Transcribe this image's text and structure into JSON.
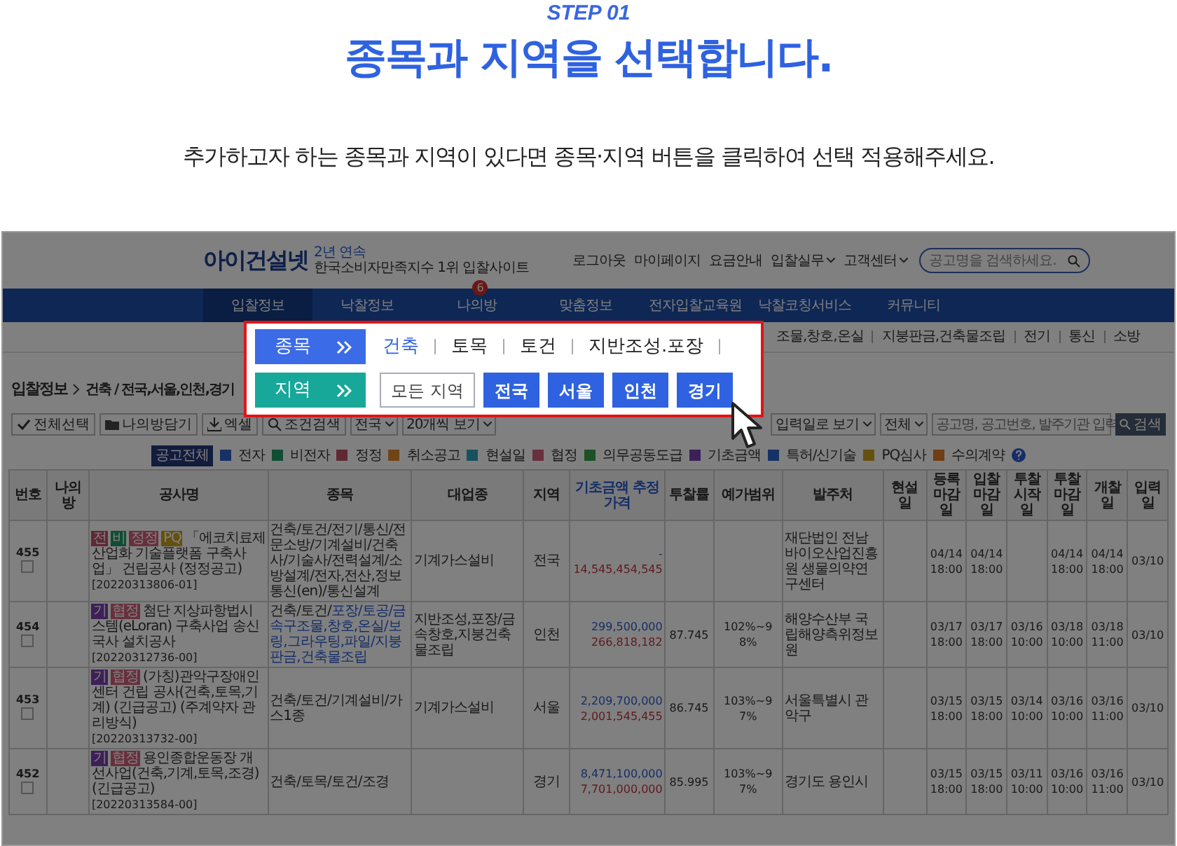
{
  "step": "STEP 01",
  "title": "종목과 지역을 선택합니다.",
  "subtitle": "추가하고자 하는 종목과 지역이 있다면 종목·지역 버튼을 클릭하여 선택 적용해주세요.",
  "site": {
    "logo": {
      "name": "아이건설넷",
      "award_top": "2년 연속",
      "award_text": "한국소비자만족지수 1위 입찰사이트"
    },
    "top_links": [
      {
        "label": "로그아웃",
        "dropdown": false
      },
      {
        "label": "마이페이지",
        "dropdown": false
      },
      {
        "label": "요금안내",
        "dropdown": false
      },
      {
        "label": "입찰실무",
        "dropdown": true
      },
      {
        "label": "고객센터",
        "dropdown": true
      }
    ],
    "search": {
      "placeholder": "공고명을 검색하세요."
    },
    "nav": [
      {
        "label": "입찰정보",
        "selected": true
      },
      {
        "label": "낙찰정보",
        "selected": false
      },
      {
        "label": "나의방",
        "selected": false,
        "badge": "6"
      },
      {
        "label": "맞춤정보",
        "selected": false
      },
      {
        "label": "전자입찰교육원",
        "selected": false
      },
      {
        "label": "낙찰코칭서비스",
        "selected": false
      },
      {
        "label": "커뮤니티",
        "selected": false
      }
    ],
    "subcategories": [
      "조물,창호,온실",
      "지붕판금,건축물조립",
      "전기",
      "통신",
      "소방"
    ],
    "breadcrumb": {
      "title": "입찰정보",
      "path": "건축 / 전국,서울,인천,경기"
    },
    "toolbar_left": [
      "전체선택",
      "나의방담기",
      "엑셀",
      "조건검색"
    ],
    "toolbar_right": {
      "selects": [
        "전국",
        "20개씩 보기",
        "입력일로 보기",
        "전체"
      ],
      "search_placeholder": "공고명, 공고번호, 발주기관 입력",
      "search_button": "검색"
    },
    "legend": {
      "filter": "공고전체",
      "items": [
        {
          "label": "전자",
          "color": "#163165"
        },
        {
          "label": "비전자",
          "color": "#104d35"
        },
        {
          "label": "정정",
          "color": "#602835"
        },
        {
          "label": "취소공고",
          "color": "#704515"
        },
        {
          "label": "현설일",
          "color": "#18505c"
        },
        {
          "label": "협정",
          "color": "#68303d"
        },
        {
          "label": "의무공동도급",
          "color": "#1d5025"
        },
        {
          "label": "기초금액",
          "color": "#3d2058"
        },
        {
          "label": "특허/신기술",
          "color": "#163165"
        },
        {
          "label": "PQ심사",
          "color": "#645010"
        },
        {
          "label": "수의계약",
          "color": "#703d15"
        }
      ]
    },
    "table": {
      "columns": [
        "번호",
        "나의방",
        "공사명",
        "종목",
        "대업종",
        "지역",
        "기초금액 추정가격",
        "투찰률",
        "예가범위",
        "발주처",
        "현설일",
        "등록 마감일",
        "입찰 마감일",
        "투찰 시작일",
        "투찰 마감일",
        "개찰일",
        "입력일"
      ],
      "rows": [
        {
          "no": "455",
          "checked": false,
          "badges": [
            {
              "text": "전",
              "color": "#602835"
            },
            {
              "text": "비",
              "color": "#104d35"
            },
            {
              "text": "정정",
              "color": "#68303d"
            },
            {
              "text": "PQ",
              "color": "#645010"
            }
          ],
          "title": "「에코치료제 산업화 기술플랫폼 구축사업」 건립공사 (정정공고)",
          "code": "[20220313806-01]",
          "category": "건축/토건/전기/통신/전문소방/기계설비/건축사/기술사/전력설계/소방설계/전자,전산,정보통신(en)/통신설계",
          "industry": "기계가스설비",
          "region": "전국",
          "base_price": "-",
          "est_price": "14,545,454,545",
          "client": "재단법인 전남바이오산업진흥원 생물의약연구센터",
          "dates": {
            "reg": [
              "04/14",
              "18:00"
            ],
            "bid": [
              "04/14",
              "18:00"
            ],
            "end": [
              "04/14",
              "18:00"
            ],
            "open": [
              "04/14",
              "18:00"
            ]
          },
          "input": "03/10"
        },
        {
          "no": "454",
          "checked": false,
          "badges": [
            {
              "text": "기",
              "color": "#3d2058"
            },
            {
              "text": "협정",
              "color": "#68303d"
            }
          ],
          "title": "첨단 지상파항법시스템(eLoran) 구축사업 송신국사 설치공사",
          "code": "[20220312736-00]",
          "category": "건축/토건/",
          "category_extra": "포장/토공/금속구조물,창호,온실/보링,그라우팅,파일/지붕판금,건축물조립",
          "industry": "지반조성,포장/금속창호,지붕건축물조립",
          "region": "인천",
          "base_price": "299,500,000",
          "est_price": "266,818,182",
          "rate": "87.745",
          "range": "102%~98%",
          "client": "해양수산부 국립해양측위정보원",
          "dates": {
            "reg": [
              "03/17",
              "18:00"
            ],
            "bid": [
              "03/17",
              "18:00"
            ],
            "start": [
              "03/16",
              "10:00"
            ],
            "end": [
              "03/18",
              "10:00"
            ],
            "open": [
              "03/18",
              "11:00"
            ]
          },
          "input": "03/10"
        },
        {
          "no": "453",
          "checked": false,
          "badges": [
            {
              "text": "기",
              "color": "#3d2058"
            },
            {
              "text": "협정",
              "color": "#68303d"
            }
          ],
          "title": "(가칭)관악구장애인센터 건립 공사(건축,토목,기계) (긴급공고) (주계약자 관리방식)",
          "code": "[20220313732-00]",
          "category": "건축/토건/기계설비/가스1종",
          "industry": "기계가스설비",
          "region": "서울",
          "base_price": "2,209,700,000",
          "est_price": "2,001,545,455",
          "rate": "86.745",
          "range": "103%~97%",
          "client": "서울특별시 관악구",
          "dates": {
            "reg": [
              "03/15",
              "18:00"
            ],
            "bid": [
              "03/15",
              "18:00"
            ],
            "start": [
              "03/14",
              "10:00"
            ],
            "end": [
              "03/16",
              "10:00"
            ],
            "open": [
              "03/16",
              "11:00"
            ]
          },
          "input": "03/10"
        },
        {
          "no": "452",
          "checked": false,
          "badges": [
            {
              "text": "기",
              "color": "#3d2058"
            },
            {
              "text": "협정",
              "color": "#68303d"
            }
          ],
          "title": "용인종합운동장 개선사업(건축,기계,토목,조경) (긴급공고)",
          "code": "[20220313584-00]",
          "category": "건축/토목/토건/조경",
          "region": "경기",
          "base_price": "8,471,100,000",
          "est_price": "7,701,000,000",
          "rate": "85.995",
          "range": "103%~97%",
          "client": "경기도 용인시",
          "dates": {
            "reg": [
              "03/15",
              "18:00"
            ],
            "bid": [
              "03/15",
              "18:00"
            ],
            "start": [
              "03/11",
              "10:00"
            ],
            "end": [
              "03/16",
              "10:00"
            ],
            "open": [
              "03/16",
              "11:00"
            ]
          },
          "input": "03/10"
        }
      ]
    }
  },
  "popup": {
    "rows": [
      {
        "label": "종목",
        "color": "#3b6be6",
        "kind": "text",
        "options": [
          {
            "label": "건축",
            "selected": true
          },
          {
            "label": "토목",
            "selected": false
          },
          {
            "label": "토건",
            "selected": false
          },
          {
            "label": "지반조성.포장",
            "selected": false
          }
        ]
      },
      {
        "label": "지역",
        "color": "#17a89a",
        "kind": "buttons",
        "options": [
          {
            "label": "모든 지역",
            "selected": false
          },
          {
            "label": "전국",
            "selected": true
          },
          {
            "label": "서울",
            "selected": true
          },
          {
            "label": "인천",
            "selected": true
          },
          {
            "label": "경기",
            "selected": true
          }
        ]
      }
    ]
  }
}
